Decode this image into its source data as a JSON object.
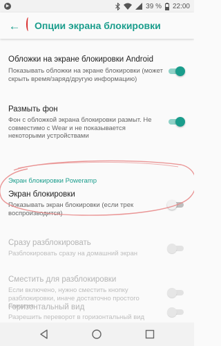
{
  "status_bar": {
    "left_icon": "play-circle-icon",
    "battery": "39 %",
    "time": "22:00",
    "icons": [
      "bluetooth-icon",
      "wifi-icon",
      "signal-icon",
      "battery-icon"
    ]
  },
  "header": {
    "back_icon": "arrow-back-icon",
    "title": "Опции экрана блокировки"
  },
  "settings": {
    "covers_on_lockscreen": {
      "title": "Обложки на экране блокировки Android",
      "summary": "Показывать обложки на экране блокировки (может скрыть время/заряд/другую информацию)",
      "enabled": true,
      "checked": true
    },
    "blur_background": {
      "title": "Размыть фон",
      "summary": "Фон с обложкой экрана блокировки размыт. Не совместимо с Wear и не показывается некоторыми устройствами",
      "enabled": true,
      "checked": true
    },
    "section_header": "Экран блокировки Poweramp",
    "lock_screen": {
      "title": "Экран блокировки",
      "summary": "Показывать экран блокировки (если трек воспроизводится)",
      "enabled": true,
      "checked": false
    },
    "unlock_immediately": {
      "title": "Сразу разблокировать",
      "summary": "Разблокировать сразу на домашний экран",
      "enabled": false,
      "checked": false
    },
    "swipe_to_unlock": {
      "title": "Сместить для разблокировки",
      "summary": "Если включено, нужно сместить кнопку разблокировки, иначе достаточно простого нажатия",
      "enabled": false,
      "checked": false
    },
    "landscape_view": {
      "title": "Горизонтальный вид",
      "summary": "Разрешить переворот в горизонтальный вид",
      "enabled": false,
      "checked": false
    }
  },
  "nav_bar": {
    "icons": [
      "nav-back-icon",
      "nav-home-icon",
      "nav-recents-icon"
    ]
  },
  "colors": {
    "accent": "#1a9d8c",
    "annotation": "#e88b8b",
    "annotation_mark": "#d92b2b"
  }
}
